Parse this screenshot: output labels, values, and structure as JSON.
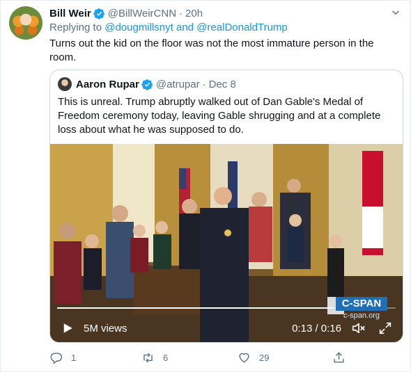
{
  "tweet": {
    "author_name": "Bill Weir",
    "author_handle": "@BillWeirCNN",
    "separator": "·",
    "time": "20h",
    "reply_prefix": "Replying to ",
    "reply_to_1": "@dougmillsnyt",
    "reply_and": " and ",
    "reply_to_2": "@realDonaldTrump",
    "text": "Turns out the kid on the floor was not the most immature person in the room."
  },
  "quoted": {
    "author_name": "Aaron Rupar",
    "author_handle": "@atrupar",
    "separator": "·",
    "date": "Dec 8",
    "text": "This is unreal. Trump abruptly walked out of Dan Gable's Medal of Freedom ceremony today, leaving Gable shrugging and at a complete loss about what he was supposed to do.",
    "video": {
      "views": "5M views",
      "timecode": "0:13 / 0:16",
      "progress_fraction": 0.8125,
      "watermark_logo": "C-SPAN",
      "watermark_url": "c-span.org"
    }
  },
  "actions": {
    "reply_count": "1",
    "retweet_count": "6",
    "like_count": "29"
  },
  "colors": {
    "link": "#1b95e0",
    "verified": "#1da1f2",
    "secondary_text": "#5b7083"
  }
}
